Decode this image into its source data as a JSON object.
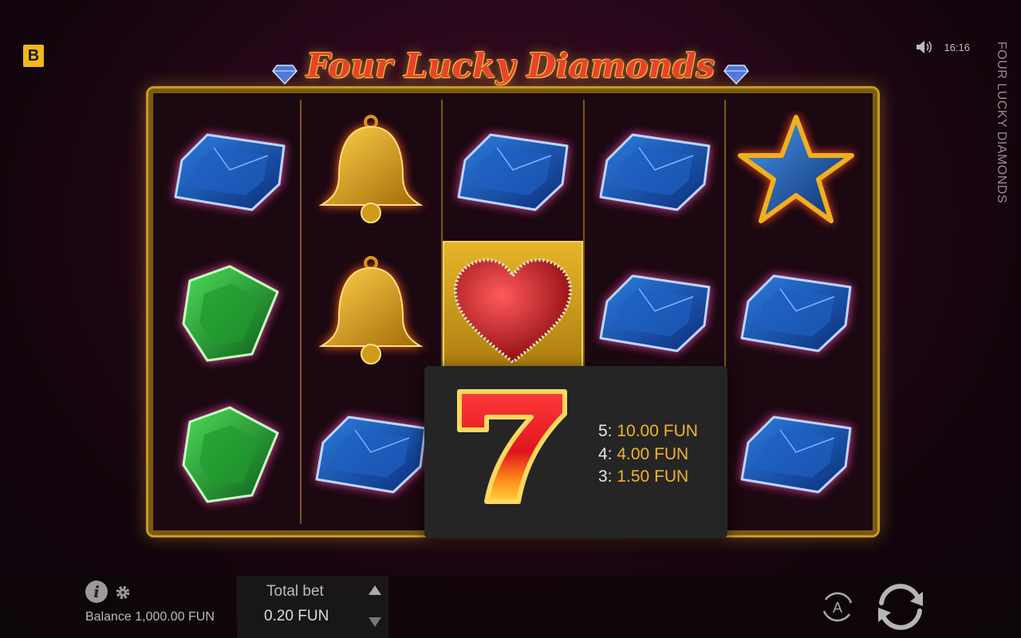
{
  "brand": {
    "badge": "B"
  },
  "status": {
    "clock": "16:16",
    "sound_icon": "speaker-icon"
  },
  "side_title": "FOUR LUCKY DIAMONDS",
  "logo": {
    "title": "Four Lucky Diamonds"
  },
  "reels": [
    [
      "blue-gem",
      "green-gem",
      "green-gem"
    ],
    [
      "bell",
      "bell",
      "blue-gem"
    ],
    [
      "blue-gem",
      "heart",
      "hidden"
    ],
    [
      "blue-gem",
      "blue-gem",
      "hidden"
    ],
    [
      "star",
      "blue-gem",
      "blue-gem"
    ]
  ],
  "popup": {
    "symbol": "seven",
    "pays": [
      {
        "count": "5:",
        "amount": "10.00 FUN"
      },
      {
        "count": "4:",
        "amount": "4.00 FUN"
      },
      {
        "count": "3:",
        "amount": "1.50 FUN"
      }
    ]
  },
  "bottom": {
    "balance": "Balance 1,000.00 FUN",
    "total_bet_label": "Total bet",
    "total_bet_value": "0.20 FUN",
    "auto_label": "A"
  },
  "colors": {
    "accent": "#f0b429",
    "frame": "#c89a20",
    "background": "#3a0c26"
  }
}
